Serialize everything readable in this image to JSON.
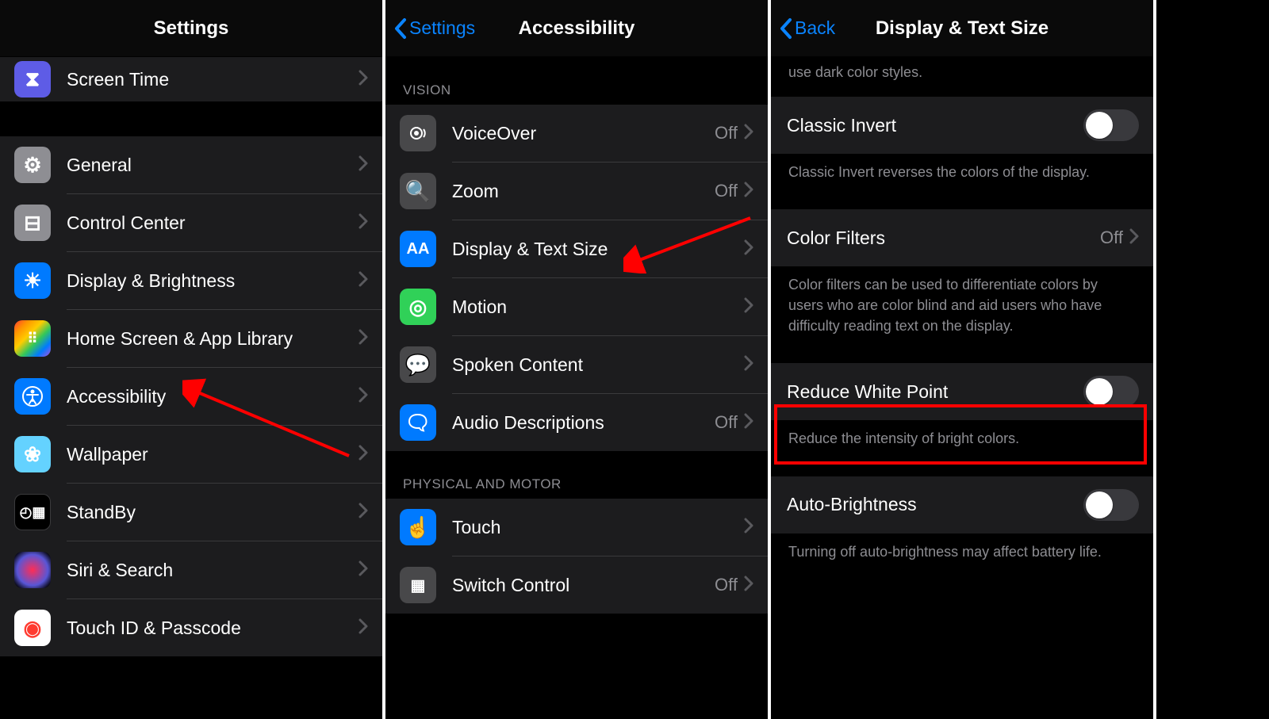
{
  "pane1": {
    "title": "Settings",
    "top_item": {
      "label": "Screen Time"
    },
    "items": [
      {
        "label": "General"
      },
      {
        "label": "Control Center"
      },
      {
        "label": "Display & Brightness"
      },
      {
        "label": "Home Screen & App Library"
      },
      {
        "label": "Accessibility"
      },
      {
        "label": "Wallpaper"
      },
      {
        "label": "StandBy"
      },
      {
        "label": "Siri & Search"
      },
      {
        "label": "Touch ID & Passcode"
      }
    ]
  },
  "pane2": {
    "back": "Settings",
    "title": "Accessibility",
    "section_vision": "VISION",
    "section_motor": "PHYSICAL AND MOTOR",
    "vision": [
      {
        "label": "VoiceOver",
        "value": "Off"
      },
      {
        "label": "Zoom",
        "value": "Off"
      },
      {
        "label": "Display & Text Size",
        "value": ""
      },
      {
        "label": "Motion",
        "value": ""
      },
      {
        "label": "Spoken Content",
        "value": ""
      },
      {
        "label": "Audio Descriptions",
        "value": "Off"
      }
    ],
    "motor": [
      {
        "label": "Touch",
        "value": ""
      },
      {
        "label": "Switch Control",
        "value": "Off"
      }
    ]
  },
  "pane3": {
    "back": "Back",
    "title": "Display & Text Size",
    "top_footer": "use dark color styles.",
    "items": [
      {
        "label": "Classic Invert",
        "footer": "Classic Invert reverses the colors of the display."
      },
      {
        "label": "Color Filters",
        "value": "Off",
        "footer": "Color filters can be used to differentiate colors by users who are color blind and aid users who have difficulty reading text on the display."
      },
      {
        "label": "Reduce White Point",
        "footer": "Reduce the intensity of bright colors."
      },
      {
        "label": "Auto-Brightness",
        "footer": "Turning off auto-brightness may affect battery life."
      }
    ]
  }
}
